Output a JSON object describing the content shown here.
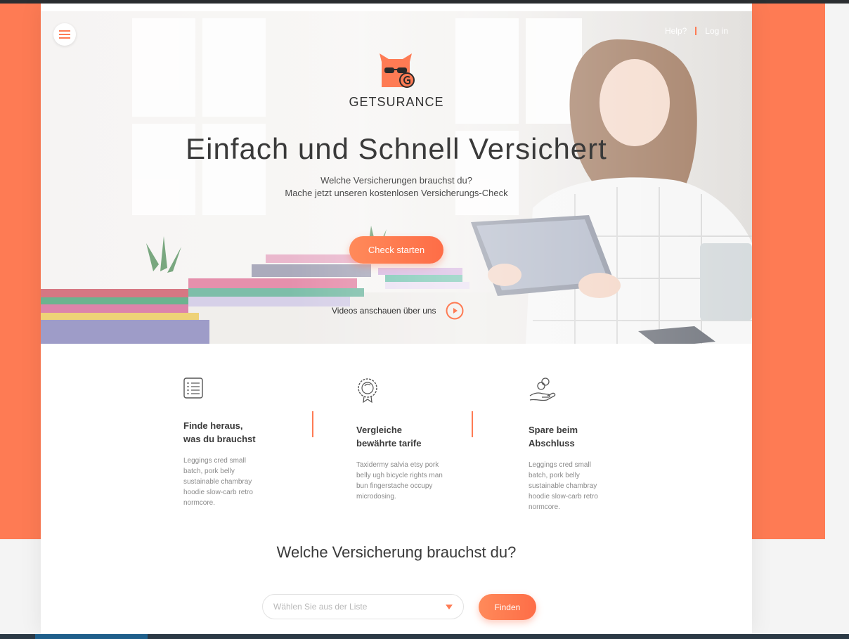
{
  "header": {
    "menu_icon": "hamburger-icon",
    "help_label": "Help?",
    "login_label": "Log in"
  },
  "brand": {
    "name": "GETSURANCE",
    "logo_icon": "cat-logo-icon"
  },
  "hero": {
    "title": "Einfach und Schnell Versichert",
    "subtitle_line1": "Welche Versicherungen brauchst du?",
    "subtitle_line2": "Mache jetzt unseren kostenlosen Versicherungs-Check",
    "cta_label": "Check starten",
    "video_label": "Videos anschauen über uns",
    "video_icon": "play-icon"
  },
  "features": [
    {
      "icon": "checklist-icon",
      "title_line1": "Finde heraus,",
      "title_line2": "was du brauchst",
      "text": "Leggings cred small batch, pork belly sustainable chambray hoodie slow-carb retro normcore."
    },
    {
      "icon": "award-badge-icon",
      "title_line1": "Vergleiche",
      "title_line2": "bewährte tarife",
      "text": "Taxidermy salvia etsy pork belly ugh bicycle rights man bun fingerstache occupy microdosing."
    },
    {
      "icon": "coins-hand-icon",
      "title_line1": "Spare beim",
      "title_line2": "Abschluss",
      "text": "Leggings cred small batch, pork belly sustainable chambray hoodie slow-carb retro normcore."
    }
  ],
  "finder": {
    "question": "Welche Versicherung brauchst du?",
    "select_placeholder": "Wählen Sie aus der Liste",
    "find_label": "Finden"
  },
  "colors": {
    "accent": "#fe7b54",
    "text_dark": "#3a3a3a"
  }
}
